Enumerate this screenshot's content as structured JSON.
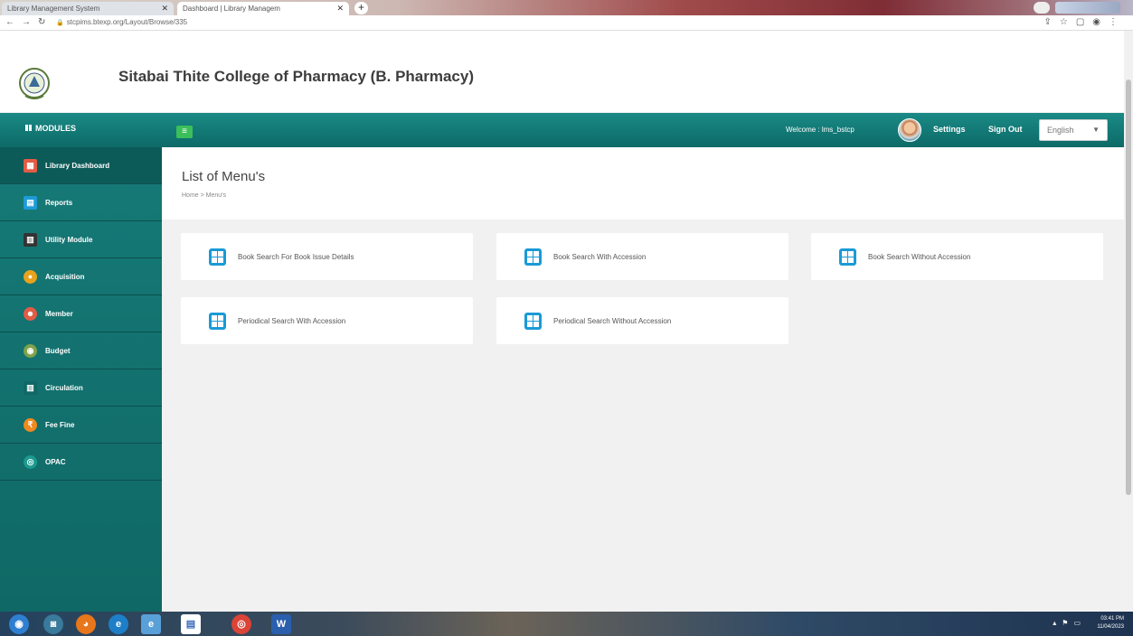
{
  "browser": {
    "tabs": [
      {
        "label": "Library Management System"
      },
      {
        "label": "Dashboard | Library Managem"
      }
    ],
    "url": "stcpims.btexp.org/Layout/Browse/335",
    "toolbar_icons": [
      "share-icon",
      "star-icon",
      "window-icon",
      "profile-icon",
      "kebab-icon"
    ]
  },
  "header": {
    "college_name": "Sitabai Thite College of Pharmacy (B. Pharmacy)"
  },
  "topbar": {
    "modules_label": "MODULES",
    "menu_button": "≡",
    "welcome_text": "Welcome : lms_bstcp",
    "settings_label": "Settings",
    "signout_label": "Sign Out",
    "language": "English"
  },
  "sidebar": {
    "items": [
      {
        "label": "Library Dashboard",
        "icon": "dashboard-icon",
        "color": "#e25b45"
      },
      {
        "label": "Reports",
        "icon": "report-icon",
        "color": "#1e9bd7"
      },
      {
        "label": "Utility Module",
        "icon": "utility-icon",
        "color": "#333333"
      },
      {
        "label": "Acquisition",
        "icon": "acquisition-icon",
        "color": "#e8a21b"
      },
      {
        "label": "Member",
        "icon": "member-icon",
        "color": "#e25b45"
      },
      {
        "label": "Budget",
        "icon": "budget-icon",
        "color": "#7fa24a"
      },
      {
        "label": "Circulation",
        "icon": "circulation-icon",
        "color": "#0f6865"
      },
      {
        "label": "Fee Fine",
        "icon": "fee-icon",
        "color": "#f08a1c"
      },
      {
        "label": "OPAC",
        "icon": "opac-icon",
        "color": "#1b9a8f"
      }
    ]
  },
  "main": {
    "title": "List of Menu's",
    "breadcrumb": "Home > Menu's",
    "cards": [
      {
        "label": "Book Search For Book Issue Details"
      },
      {
        "label": "Book Search With Accession"
      },
      {
        "label": "Book Search Without Accession"
      },
      {
        "label": "Periodical Search With Accession"
      },
      {
        "label": "Periodical Search Without Accession"
      }
    ]
  },
  "taskbar": {
    "time": "03:41 PM",
    "date": "11/04/2023"
  },
  "colors": {
    "teal": "#0f6865",
    "accent_blue": "#1a9ad6",
    "menu_green": "#3bbf5a"
  }
}
